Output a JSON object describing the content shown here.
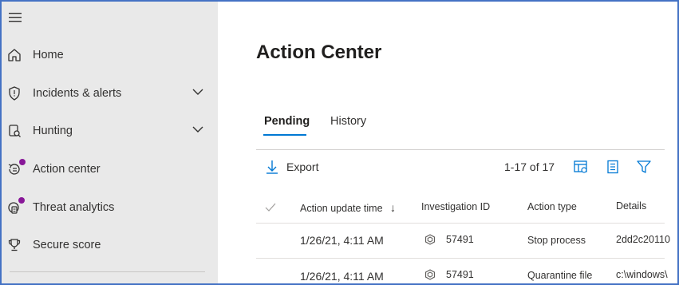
{
  "sidebar": {
    "items": [
      {
        "label": "Home",
        "icon": "home-icon",
        "has_chevron": false,
        "has_dot": false
      },
      {
        "label": "Incidents & alerts",
        "icon": "shield-icon",
        "has_chevron": true,
        "has_dot": false
      },
      {
        "label": "Hunting",
        "icon": "hunting-icon",
        "has_chevron": true,
        "has_dot": false
      },
      {
        "label": "Action center",
        "icon": "action-center-icon",
        "has_chevron": false,
        "has_dot": true
      },
      {
        "label": "Threat analytics",
        "icon": "threat-analytics-icon",
        "has_chevron": false,
        "has_dot": true
      },
      {
        "label": "Secure score",
        "icon": "trophy-icon",
        "has_chevron": false,
        "has_dot": false
      }
    ],
    "dot_color": "#881798"
  },
  "main": {
    "title": "Action Center",
    "tabs": [
      {
        "label": "Pending",
        "active": true
      },
      {
        "label": "History",
        "active": false
      }
    ],
    "toolbar": {
      "export_label": "Export",
      "count_text": "1-17 of 17",
      "icons": [
        "customize-columns-icon",
        "list-view-icon",
        "filter-icon"
      ]
    },
    "table": {
      "headers": [
        "Action update time",
        "Investigation ID",
        "Action type",
        "Details"
      ],
      "sort_indicator": "↓",
      "rows": [
        {
          "time": "1/26/21, 4:11 AM",
          "investigation_id": "57491",
          "action_type": "Stop process",
          "details": "2dd2c20110"
        },
        {
          "time": "1/26/21, 4:11 AM",
          "investigation_id": "57491",
          "action_type": "Quarantine file",
          "details": "c:\\windows\\"
        }
      ]
    }
  },
  "colors": {
    "accent": "#0078d4",
    "sidebar_bg": "#e9e9e9",
    "frame": "#4472c4"
  }
}
